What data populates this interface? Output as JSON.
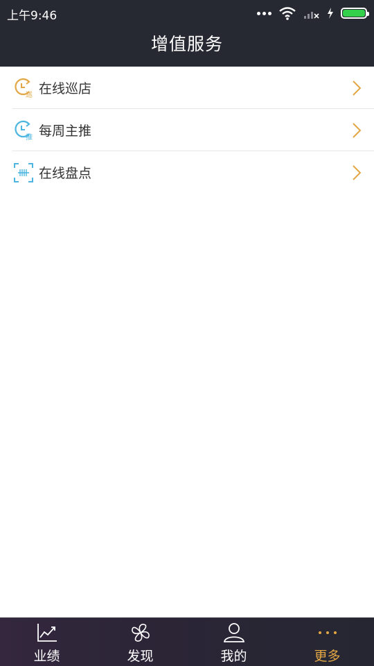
{
  "status": {
    "time": "上午9:46"
  },
  "header": {
    "title": "增值服务"
  },
  "colors": {
    "header_bg": "#262832",
    "accent": "#e2a744",
    "teal": "#4cb6e0"
  },
  "list": [
    {
      "label": "在线巡店",
      "icon": "clock-patrol-icon",
      "icon_char": "巡"
    },
    {
      "label": "每周主推",
      "icon": "clock-promote-icon",
      "icon_char": "推"
    },
    {
      "label": "在线盘点",
      "icon": "barcode-scan-icon"
    }
  ],
  "tabs": [
    {
      "label": "业绩",
      "icon": "chart-line-icon",
      "active": false
    },
    {
      "label": "发现",
      "icon": "pinwheel-icon",
      "active": false
    },
    {
      "label": "我的",
      "icon": "user-icon",
      "active": false
    },
    {
      "label": "更多",
      "icon": "more-dots-icon",
      "active": true
    }
  ]
}
